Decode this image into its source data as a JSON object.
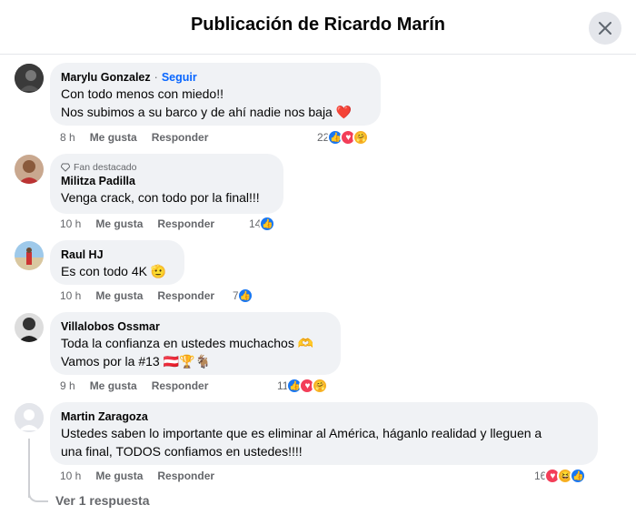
{
  "header": {
    "title": "Publicación de Ricardo Marín"
  },
  "comments": [
    {
      "author": "Marylu Gonzalez",
      "follow": "Seguir",
      "lines": [
        "Con todo menos con miedo!!",
        "Nos subimos a su barco y de ahí nadie nos baja ❤️"
      ],
      "time": "8 h",
      "like": "Me gusta",
      "reply": "Responder",
      "reactions": {
        "count": "22",
        "types": [
          "like",
          "love",
          "care"
        ]
      }
    },
    {
      "badge": "Fan destacado",
      "author": "Militza Padilla",
      "lines": [
        "Venga crack, con todo por la final!!!"
      ],
      "time": "10 h",
      "like": "Me gusta",
      "reply": "Responder",
      "reactions": {
        "count": "14",
        "types": [
          "like"
        ]
      }
    },
    {
      "author": "Raul HJ",
      "lines": [
        "Es con todo 4K 🫡"
      ],
      "time": "10 h",
      "like": "Me gusta",
      "reply": "Responder",
      "reactions": {
        "count": "7",
        "types": [
          "like"
        ]
      }
    },
    {
      "author": "Villalobos Ossmar",
      "lines": [
        "Toda la confianza en ustedes muchachos 🫶",
        "Vamos por la #13 🇦🇹🏆🐐"
      ],
      "time": "9 h",
      "like": "Me gusta",
      "reply": "Responder",
      "reactions": {
        "count": "11",
        "types": [
          "like",
          "love",
          "care"
        ]
      }
    },
    {
      "author": "Martin Zaragoza",
      "lines": [
        "Ustedes saben lo importante que es eliminar al América, háganlo realidad y lleguen a",
        "una final, TODOS confiamos en ustedes!!!!"
      ],
      "time": "10 h",
      "like": "Me gusta",
      "reply": "Responder",
      "reactions": {
        "count": "16",
        "types": [
          "love",
          "haha",
          "like"
        ]
      },
      "see_replies": "Ver 1 respuesta"
    }
  ],
  "colors": {
    "accent": "#0866ff",
    "bubble": "#f0f2f5",
    "muted": "#65676b",
    "like": "#1877f2",
    "love": "#f33e58",
    "care": "#f7b125"
  },
  "icons": {
    "close": "close-icon",
    "badge": "diamond-icon"
  }
}
